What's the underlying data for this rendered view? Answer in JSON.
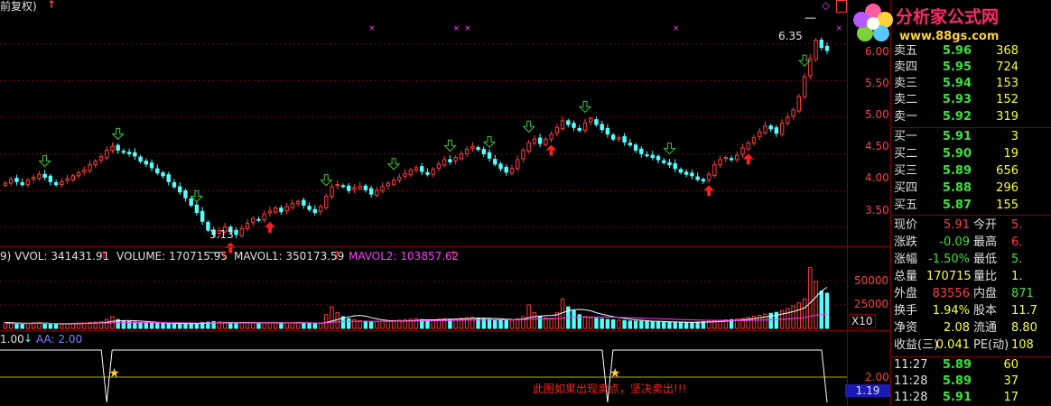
{
  "header": {
    "adjust_label": "前复权)",
    "volume_header": {
      "vvol": "9) VVOL: 341431.91",
      "volume": "VOLUME: 170715.95",
      "mavol1": "MAVOL1: 350173.59",
      "mavol2": "MAVOL2: 103857.62"
    },
    "indicator_header": {
      "value": "1.00",
      "aa": "AA: 2.00"
    }
  },
  "watermark": {
    "brand": "分析家公式网",
    "url": "www.88gs.com"
  },
  "annotation_text": "此图如果出现卖点，坚决卖出!!!",
  "order_book": {
    "sell": [
      {
        "label": "卖五",
        "price": "5.96",
        "vol": "368"
      },
      {
        "label": "卖四",
        "price": "5.95",
        "vol": "724"
      },
      {
        "label": "卖三",
        "price": "5.94",
        "vol": "153"
      },
      {
        "label": "卖二",
        "price": "5.93",
        "vol": "152"
      },
      {
        "label": "卖一",
        "price": "5.92",
        "vol": "319"
      }
    ],
    "buy": [
      {
        "label": "买一",
        "price": "5.91",
        "vol": "3"
      },
      {
        "label": "买二",
        "price": "5.90",
        "vol": "19"
      },
      {
        "label": "买三",
        "price": "5.89",
        "vol": "656"
      },
      {
        "label": "买四",
        "price": "5.88",
        "vol": "296"
      },
      {
        "label": "买五",
        "price": "5.87",
        "vol": "155"
      }
    ]
  },
  "quote": [
    {
      "l1": "现价",
      "v1": "5.91",
      "c1": "#ff4040",
      "l2": "今开",
      "v2": "5.",
      "c2": "#ff4040"
    },
    {
      "l1": "涨跌",
      "v1": "-0.09",
      "c1": "#40e040",
      "l2": "最高",
      "v2": "6.",
      "c2": "#ff4040"
    },
    {
      "l1": "涨幅",
      "v1": "-1.50%",
      "c1": "#40e040",
      "l2": "最低",
      "v2": "5.",
      "c2": "#40e040"
    },
    {
      "l1": "总量",
      "v1": "170715",
      "c1": "#ffff3c",
      "l2": "量比",
      "v2": "1.",
      "c2": "#ffff3c"
    },
    {
      "l1": "外盘",
      "v1": "83556",
      "c1": "#ff4040",
      "l2": "内盘",
      "v2": "871",
      "c2": "#40e040"
    },
    {
      "l1": "换手",
      "v1": "1.94%",
      "c1": "#ffff3c",
      "l2": "股本",
      "v2": "11.7",
      "c2": "#ffff3c"
    },
    {
      "l1": "净资",
      "v1": "2.08",
      "c1": "#ffff3c",
      "l2": "流通",
      "v2": "8.80",
      "c2": "#ffff3c"
    },
    {
      "l1": "收益(三)",
      "v1": "0.041",
      "c1": "#ffff3c",
      "l2": "PE(动)",
      "v2": "108",
      "c2": "#ffff3c"
    }
  ],
  "ticks": [
    {
      "time": "11:27",
      "price": "5.89",
      "vol": "60"
    },
    {
      "time": "11:28",
      "price": "5.89",
      "vol": "37"
    },
    {
      "time": "11:28",
      "price": "5.91",
      "vol": "17"
    }
  ],
  "colors": {
    "up": "#ff3c3c",
    "down": "#54ffff",
    "grid": "#8a0000",
    "signal_buy": "#ff1e1e",
    "signal_sell": "#3cc83c",
    "ma": "#ffffff",
    "mavol2": "#ff3cff"
  },
  "chart_data": {
    "type": "candlestick",
    "price_axis": {
      "ticks": [
        "6.00",
        "5.50",
        "5.00",
        "4.50",
        "4.00",
        "3.50"
      ],
      "ylim": [
        3.3,
        6.45
      ]
    },
    "volume_axis": {
      "ticks": [
        "50000",
        "25000"
      ],
      "unit": "X10",
      "ylim": [
        0,
        70000
      ]
    },
    "indicator_axis": {
      "ticks": [
        "2.00"
      ],
      "current": "1.19"
    },
    "annotations": {
      "high_label": "6.35",
      "low_label": "3.13",
      "high": 6.35,
      "low": 3.13
    },
    "close": [
      4.1,
      4.15,
      4.12,
      4.08,
      4.14,
      4.18,
      4.22,
      4.18,
      4.12,
      4.08,
      4.12,
      4.16,
      4.2,
      4.24,
      4.28,
      4.35,
      4.4,
      4.46,
      4.55,
      4.6,
      4.55,
      4.52,
      4.5,
      4.47,
      4.4,
      4.36,
      4.31,
      4.24,
      4.2,
      4.12,
      4.05,
      3.98,
      3.9,
      3.8,
      3.7,
      3.58,
      3.46,
      3.4,
      3.45,
      3.5,
      3.44,
      3.4,
      3.48,
      3.55,
      3.62,
      3.6,
      3.68,
      3.72,
      3.76,
      3.71,
      3.78,
      3.82,
      3.85,
      3.8,
      3.74,
      3.7,
      3.78,
      3.92,
      4.05,
      4.08,
      4.06,
      4.0,
      4.04,
      4.06,
      4.01,
      3.95,
      4.0,
      4.05,
      4.1,
      4.14,
      4.18,
      4.23,
      4.28,
      4.31,
      4.26,
      4.22,
      4.29,
      4.36,
      4.42,
      4.39,
      4.45,
      4.5,
      4.56,
      4.6,
      4.56,
      4.5,
      4.44,
      4.36,
      4.3,
      4.25,
      4.3,
      4.42,
      4.55,
      4.65,
      4.7,
      4.64,
      4.7,
      4.77,
      4.86,
      4.95,
      4.9,
      4.86,
      4.82,
      4.92,
      4.98,
      4.9,
      4.83,
      4.77,
      4.7,
      4.72,
      4.66,
      4.62,
      4.55,
      4.5,
      4.48,
      4.45,
      4.42,
      4.38,
      4.35,
      4.3,
      4.25,
      4.22,
      4.2,
      4.15,
      4.13,
      4.22,
      4.35,
      4.42,
      4.45,
      4.42,
      4.48,
      4.58,
      4.65,
      4.72,
      4.8,
      4.88,
      4.84,
      4.78,
      4.92,
      5.0,
      5.1,
      5.28,
      5.55,
      5.8,
      6.05,
      5.95,
      5.91
    ],
    "volume": [
      6000,
      5500,
      5000,
      4800,
      5200,
      5600,
      5800,
      5000,
      4600,
      4200,
      4400,
      4800,
      5000,
      5400,
      5600,
      6000,
      6400,
      7000,
      9000,
      12000,
      9000,
      7600,
      7000,
      6400,
      6000,
      5800,
      5400,
      5200,
      5000,
      4800,
      4600,
      4600,
      4800,
      5000,
      5400,
      6000,
      6400,
      7000,
      6600,
      6200,
      5800,
      5400,
      5600,
      5800,
      6000,
      5600,
      5400,
      5600,
      5800,
      5400,
      5600,
      5800,
      6000,
      5400,
      5000,
      5000,
      5400,
      14000,
      22000,
      16000,
      12000,
      10000,
      9000,
      8000,
      7400,
      6800,
      7000,
      7400,
      7800,
      8000,
      8400,
      8800,
      9400,
      9800,
      9000,
      8400,
      8800,
      9400,
      10000,
      9400,
      9800,
      10400,
      11000,
      11400,
      10600,
      9800,
      9400,
      8800,
      8400,
      8000,
      8400,
      9800,
      12000,
      24000,
      16000,
      12000,
      10800,
      10400,
      16000,
      30000,
      22000,
      18000,
      14000,
      12000,
      11000,
      10400,
      9800,
      9200,
      8800,
      8400,
      8000,
      7600,
      7400,
      7200,
      7000,
      6800,
      6600,
      6400,
      6200,
      6000,
      6000,
      5800,
      6000,
      6400,
      6800,
      7200,
      7800,
      8400,
      8800,
      9000,
      9600,
      10400,
      11400,
      12400,
      13400,
      14600,
      15400,
      16400,
      18200,
      20400,
      23000,
      26000,
      30000,
      62000,
      48000,
      38000,
      36000
    ],
    "mavol1": [
      6000,
      5800,
      5500,
      5300,
      5200,
      5300,
      5400,
      5400,
      5200,
      5000,
      4800,
      4700,
      4700,
      4800,
      5000,
      5200,
      5400,
      5700,
      6200,
      7200,
      7700,
      7900,
      7900,
      7800,
      7500,
      7100,
      6600,
      6200,
      5800,
      5500,
      5200,
      5000,
      4900,
      4800,
      4900,
      5000,
      5200,
      5400,
      5600,
      5800,
      5900,
      5900,
      5900,
      5900,
      5800,
      5800,
      5700,
      5700,
      5700,
      5700,
      5600,
      5600,
      5700,
      5700,
      5600,
      5500,
      5400,
      6000,
      7500,
      9000,
      10500,
      11800,
      12800,
      13200,
      12500,
      11000,
      9800,
      8700,
      8100,
      7700,
      7500,
      7600,
      7800,
      8100,
      8500,
      8700,
      8800,
      8900,
      9100,
      9300,
      9400,
      9600,
      9900,
      10200,
      10400,
      10500,
      10300,
      10100,
      9800,
      9400,
      9100,
      9000,
      9400,
      11000,
      12000,
      12600,
      13000,
      13200,
      13800,
      16000,
      18000,
      19000,
      19500,
      19000,
      18000,
      16000,
      14500,
      13200,
      12000,
      11000,
      10200,
      9500,
      8800,
      8300,
      7800,
      7400,
      7200,
      7000,
      6800,
      6600,
      6400,
      6300,
      6200,
      6200,
      6300,
      6500,
      6700,
      7000,
      7400,
      7800,
      8200,
      8700,
      9300,
      10000,
      10800,
      11600,
      12500,
      13500,
      14600,
      15800,
      17200,
      18900,
      21000,
      26000,
      32000,
      38000,
      42000
    ],
    "mavol2": [
      5000,
      5000,
      5000,
      5000,
      5000,
      5000,
      5100,
      5100,
      5100,
      5100,
      5100,
      5100,
      5200,
      5200,
      5200,
      5300,
      5300,
      5400,
      5500,
      5700,
      5800,
      5900,
      5900,
      5900,
      5900,
      5900,
      5900,
      5900,
      5900,
      5800,
      5800,
      5700,
      5600,
      5600,
      5500,
      5500,
      5500,
      5500,
      5500,
      5500,
      5500,
      5500,
      5500,
      5500,
      5500,
      5500,
      5500,
      5500,
      5500,
      5500,
      5500,
      5500,
      5500,
      5500,
      5500,
      5500,
      5500,
      5800,
      6300,
      6600,
      6800,
      7000,
      7100,
      7200,
      7200,
      7200,
      7200,
      7200,
      7200,
      7300,
      7300,
      7400,
      7500,
      7600,
      7700,
      7700,
      7800,
      7900,
      8000,
      8100,
      8200,
      8300,
      8400,
      8500,
      8600,
      8600,
      8700,
      8700,
      8700,
      8700,
      8700,
      8800,
      8900,
      9300,
      9500,
      9600,
      9700,
      9800,
      10000,
      10500,
      10900,
      11200,
      11400,
      11500,
      11600,
      11600,
      11600,
      11500,
      11400,
      11300,
      11100,
      10900,
      10700,
      10500,
      10300,
      10100,
      9900,
      9700,
      9500,
      9300,
      9100,
      8900,
      8700,
      8500,
      8400,
      8300,
      8200,
      8100,
      8100,
      8100,
      8100,
      8100,
      8200,
      8300,
      8400,
      8600,
      8800,
      9000,
      9300,
      9600,
      10000,
      10500,
      11000,
      12500,
      13500,
      14300,
      15000
    ],
    "buy_signals": [
      40,
      47,
      97,
      125,
      132
    ],
    "sell_signals": [
      7,
      20,
      34,
      57,
      69,
      79,
      86,
      93,
      103,
      118,
      142
    ],
    "top_markers": [
      65,
      80,
      82,
      119,
      148
    ],
    "indicator_dips": [
      18,
      107
    ]
  }
}
